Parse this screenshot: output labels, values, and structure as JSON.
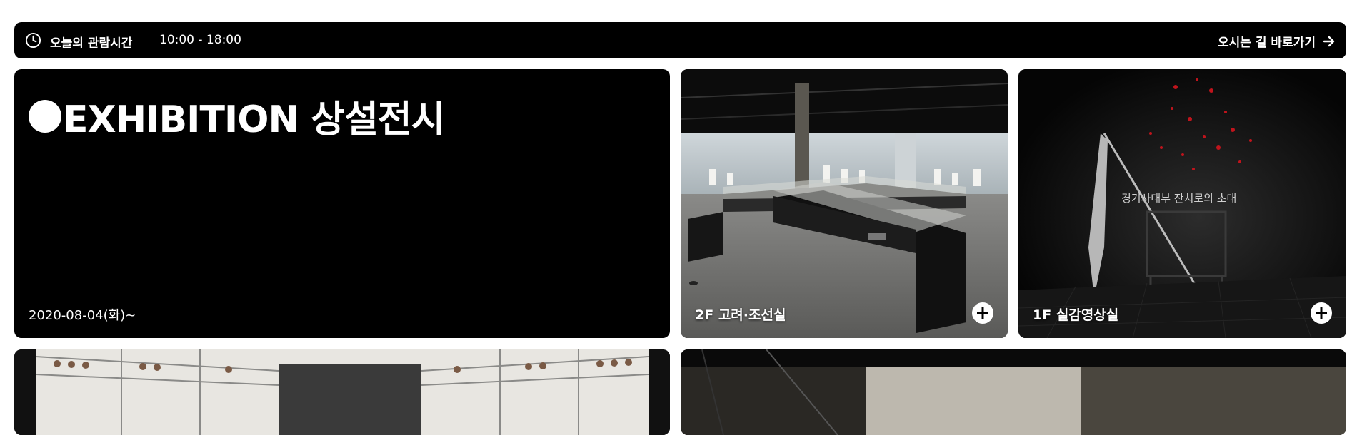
{
  "info_bar": {
    "hours_label": "오늘의 관람시간",
    "hours_value": "10:00 - 18:00",
    "directions_label": "오시는 길 바로가기",
    "icons": [
      "clock-icon",
      "arrow-right-icon"
    ]
  },
  "exhibition": {
    "title": "EXHIBITION 상설전시",
    "date": "2020-08-04(화)~"
  },
  "rooms": [
    {
      "label": "2F 고려·조선실"
    },
    {
      "label": "1F 실감영상실",
      "caption": "경기사대부 잔치로의 초대"
    }
  ],
  "colors": {
    "bar": "#000000",
    "text": "#ffffff",
    "page": "#ffffff"
  }
}
